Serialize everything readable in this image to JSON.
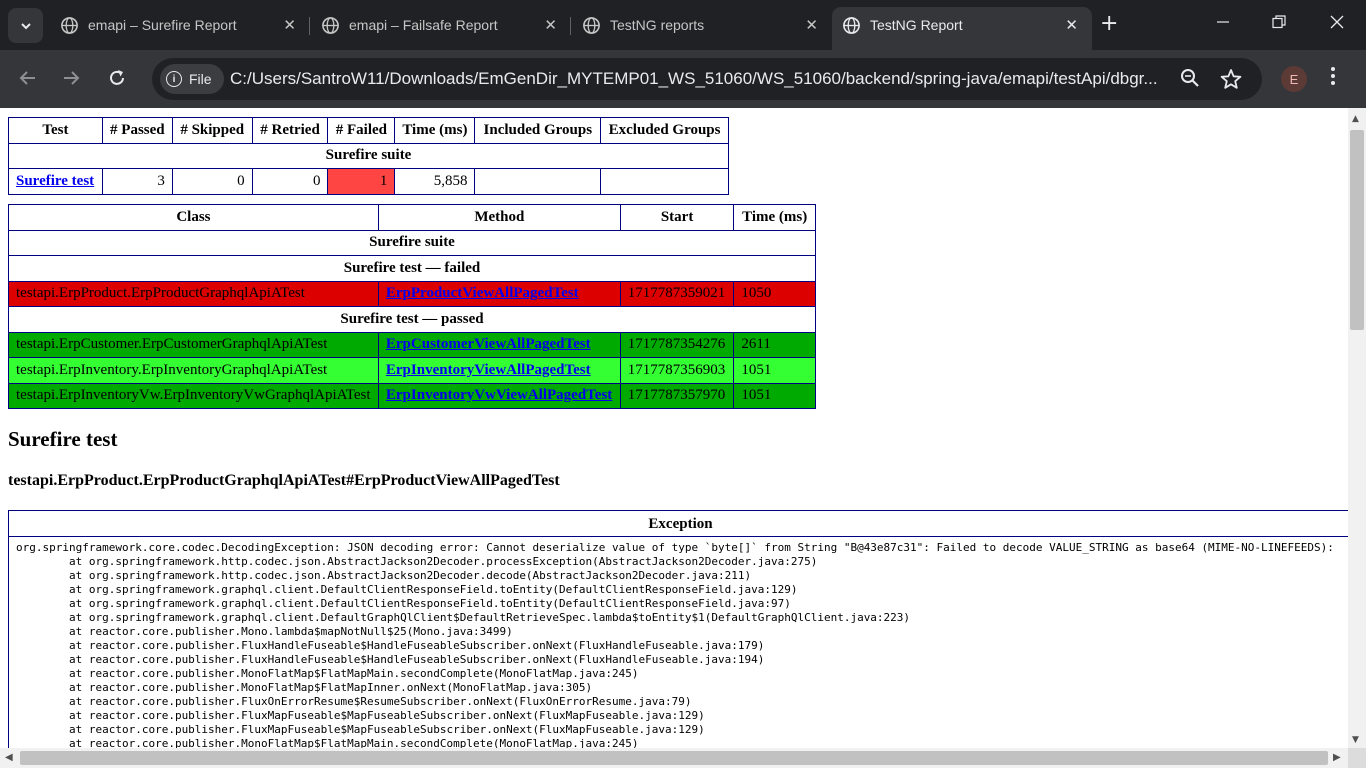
{
  "browser": {
    "tabs": [
      {
        "title": "emapi – Surefire Report"
      },
      {
        "title": "emapi – Failsafe Report"
      },
      {
        "title": "TestNG reports"
      },
      {
        "title": "TestNG Report"
      }
    ],
    "chip_label": "File",
    "url": "C:/Users/SantroW11/Downloads/EmGenDir_MYTEMP01_WS_51060/WS_51060/backend/spring-java/emapi/testApi/dbgr...",
    "profile_initial": "E"
  },
  "summary": {
    "headers": [
      "Test",
      "# Passed",
      "# Skipped",
      "# Retried",
      "# Failed",
      "Time (ms)",
      "Included Groups",
      "Excluded Groups"
    ],
    "suite_name": "Surefire suite",
    "row": {
      "test": "Surefire test",
      "passed": "3",
      "skipped": "0",
      "retried": "0",
      "failed": "1",
      "time": "5,858",
      "included": "",
      "excluded": ""
    }
  },
  "methods": {
    "headers": [
      "Class",
      "Method",
      "Start",
      "Time (ms)"
    ],
    "suite_name": "Surefire suite",
    "failed_label": "Surefire test — failed",
    "passed_label": "Surefire test — passed",
    "failed": [
      {
        "class": "testapi.ErpProduct.ErpProductGraphqlApiATest",
        "method": "ErpProductViewAllPagedTest",
        "start": "1717787359021",
        "time": "1050"
      }
    ],
    "passed": [
      {
        "class": "testapi.ErpCustomer.ErpCustomerGraphqlApiATest",
        "method": "ErpCustomerViewAllPagedTest",
        "start": "1717787354276",
        "time": "2611"
      },
      {
        "class": "testapi.ErpInventory.ErpInventoryGraphqlApiATest",
        "method": "ErpInventoryViewAllPagedTest",
        "start": "1717787356903",
        "time": "1051"
      },
      {
        "class": "testapi.ErpInventoryVw.ErpInventoryVwGraphqlApiATest",
        "method": "ErpInventoryVwViewAllPagedTest",
        "start": "1717787357970",
        "time": "1051"
      }
    ]
  },
  "detail": {
    "test_heading": "Surefire test",
    "method_heading": "testapi.ErpProduct.ErpProductGraphqlApiATest#ErpProductViewAllPagedTest",
    "exception_header": "Exception",
    "stacktrace": [
      "org.springframework.core.codec.DecodingException: JSON decoding error: Cannot deserialize value of type `byte[]` from String \"B@43e87c31\": Failed to decode VALUE_STRING as base64 (MIME-NO-LINEFEEDS):",
      "        at org.springframework.http.codec.json.AbstractJackson2Decoder.processException(AbstractJackson2Decoder.java:275)",
      "        at org.springframework.http.codec.json.AbstractJackson2Decoder.decode(AbstractJackson2Decoder.java:211)",
      "        at org.springframework.graphql.client.DefaultClientResponseField.toEntity(DefaultClientResponseField.java:129)",
      "        at org.springframework.graphql.client.DefaultClientResponseField.toEntity(DefaultClientResponseField.java:97)",
      "        at org.springframework.graphql.client.DefaultGraphQlClient$DefaultRetrieveSpec.lambda$toEntity$1(DefaultGraphQlClient.java:223)",
      "        at reactor.core.publisher.Mono.lambda$mapNotNull$25(Mono.java:3499)",
      "        at reactor.core.publisher.FluxHandleFuseable$HandleFuseableSubscriber.onNext(FluxHandleFuseable.java:179)",
      "        at reactor.core.publisher.FluxHandleFuseable$HandleFuseableSubscriber.onNext(FluxHandleFuseable.java:194)",
      "        at reactor.core.publisher.MonoFlatMap$FlatMapMain.secondComplete(MonoFlatMap.java:245)",
      "        at reactor.core.publisher.MonoFlatMap$FlatMapInner.onNext(MonoFlatMap.java:305)",
      "        at reactor.core.publisher.FluxOnErrorResume$ResumeSubscriber.onNext(FluxOnErrorResume.java:79)",
      "        at reactor.core.publisher.FluxMapFuseable$MapFuseableSubscriber.onNext(FluxMapFuseable.java:129)",
      "        at reactor.core.publisher.FluxMapFuseable$MapFuseableSubscriber.onNext(FluxMapFuseable.java:129)",
      "        at reactor.core.publisher.MonoFlatMap$FlatMapMain.secondComplete(MonoFlatMap.java:245)"
    ]
  },
  "icons": {
    "tab_favicon": "globe-icon",
    "search_tabs": "chevron-down-icon",
    "back": "arrow-left-icon",
    "forward": "arrow-right-icon",
    "reload": "reload-icon",
    "zoom": "magnifier-icon",
    "bookmark": "star-icon",
    "menu": "kebab-menu-icon"
  },
  "colors": {
    "failed_row": "#dd0000",
    "failed_count": "#ff4444",
    "passed_row_dark": "#00aa00",
    "passed_row_light": "#33ff33",
    "link": "#0000ee",
    "table_border": "#000080"
  }
}
